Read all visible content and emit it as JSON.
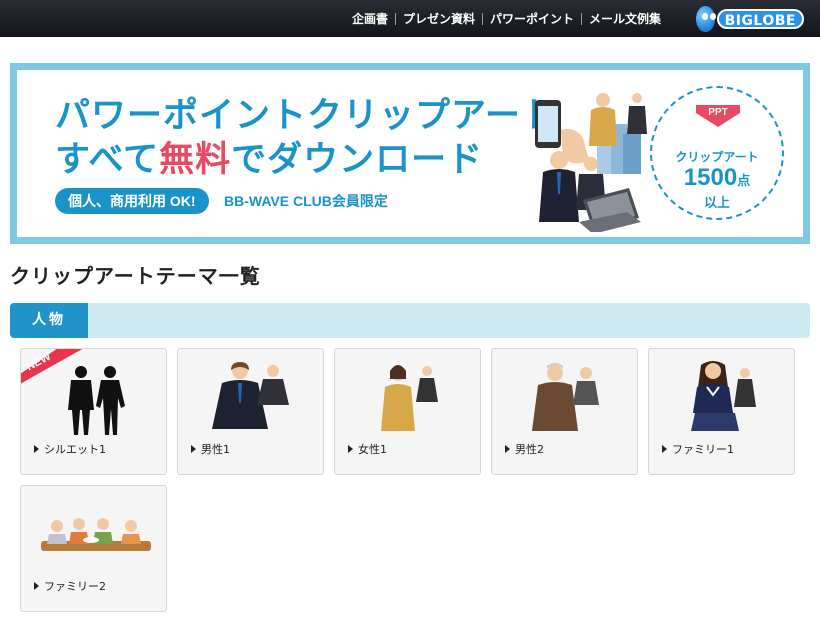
{
  "header": {
    "nav": [
      "企画書",
      "プレゼン資料",
      "パワーポイント",
      "メール文例集"
    ],
    "logo_text": "BIGLOBE"
  },
  "banner": {
    "line1": "パワーポイントクリップアート",
    "line2_pre": "すべて",
    "line2_highlight": "無料",
    "line2_post": "でダウンロード",
    "pill": "個人、商用利用 OK!",
    "member": "BB-WAVE CLUB会員限定",
    "ppt_tag": "PPT",
    "circle_label": "クリップアート",
    "circle_count": "1500",
    "circle_unit": "点",
    "circle_sub": "以上",
    "colors": {
      "accent": "#1a94c8",
      "highlight": "#e84a64",
      "frame": "#7ec9e3"
    }
  },
  "main": {
    "title": "クリップアートテーマ一覧",
    "category": "人物",
    "new_badge": "NEW",
    "cards": [
      {
        "label": "シルエット1",
        "icon": "silhouette-people"
      },
      {
        "label": "男性1",
        "icon": "businessman"
      },
      {
        "label": "女性1",
        "icon": "businesswoman"
      },
      {
        "label": "男性2",
        "icon": "senior-businessman"
      },
      {
        "label": "ファミリー1",
        "icon": "schoolgirl"
      },
      {
        "label": "ファミリー2",
        "icon": "family-dining"
      }
    ]
  }
}
